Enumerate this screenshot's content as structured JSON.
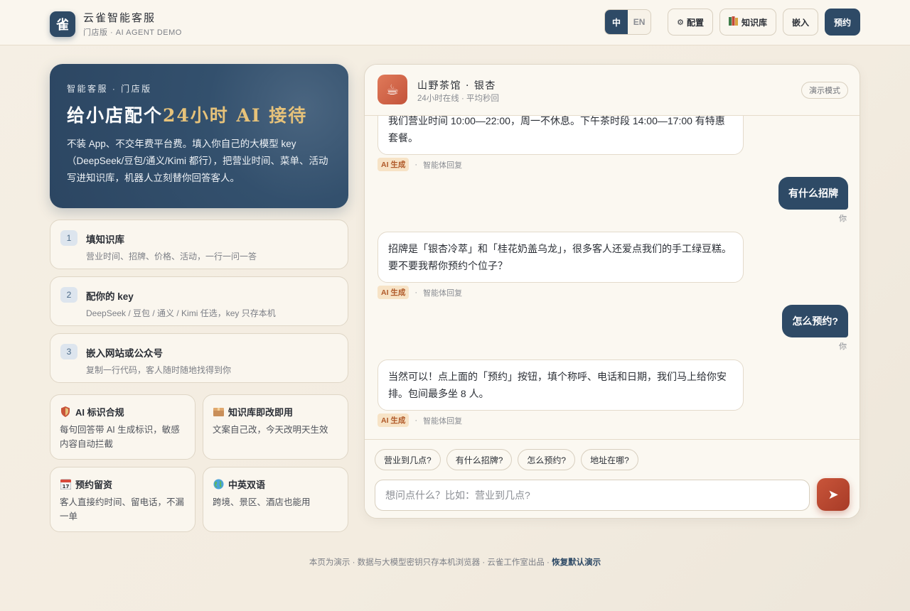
{
  "header": {
    "logo_char": "雀",
    "title": "云雀智能客服",
    "subtitle": "门店版 · AI AGENT DEMO",
    "lang_zh": "中",
    "lang_en": "EN",
    "btn_config": "配置",
    "btn_knowledge": "知识库",
    "btn_embed": "嵌入",
    "btn_book": "预约"
  },
  "hero": {
    "tag": "智能客服 · 门店版",
    "title_pre": "给小店配个",
    "title_accent": "24小时 AI 接待",
    "desc": "不装 App、不交年费平台费。填入你自己的大模型 key（DeepSeek/豆包/通义/Kimi 都行），把营业时间、菜单、活动写进知识库，机器人立刻替你回答客人。"
  },
  "steps": [
    {
      "num": "1",
      "title": "填知识库",
      "desc": "营业时间、招牌、价格、活动，一行一问一答"
    },
    {
      "num": "2",
      "title": "配你的 key",
      "desc": "DeepSeek / 豆包 / 通义 / Kimi 任选，key 只存本机"
    },
    {
      "num": "3",
      "title": "嵌入网站或公众号",
      "desc": "复制一行代码，客人随时随地找得到你"
    }
  ],
  "features": [
    {
      "icon": "shield-icon",
      "title": "AI 标识合规",
      "desc": "每句回答带 AI 生成标识，敏感内容自动拦截"
    },
    {
      "icon": "box-icon",
      "title": "知识库即改即用",
      "desc": "文案自己改，今天改明天生效"
    },
    {
      "icon": "calendar-icon",
      "title": "预约留资",
      "desc": "客人直接约时间、留电话，不漏一单"
    },
    {
      "icon": "globe-icon",
      "title": "中英双语",
      "desc": "跨境、景区、酒店也能用"
    }
  ],
  "chat": {
    "store_name": "山野茶馆 · 银杏",
    "store_status": "24小时在线 · 平均秒回",
    "mode_badge": "演示模式",
    "ai_tag": "AI 生成",
    "ai_meta": "智能体回复",
    "me_meta": "你",
    "messages": [
      {
        "role": "ai",
        "text": "我们营业时间 10:00—22:00，周一不休息。下午茶时段 14:00—17:00 有特惠套餐。"
      },
      {
        "role": "me",
        "text": "有什么招牌"
      },
      {
        "role": "ai",
        "text": "招牌是「银杏冷萃」和「桂花奶盖乌龙」，很多客人还爱点我们的手工绿豆糕。要不要我帮你预约个位子？"
      },
      {
        "role": "me",
        "text": "怎么预约?"
      },
      {
        "role": "ai",
        "text": "当然可以！点上面的「预约」按钮，填个称呼、电话和日期，我们马上给你安排。包间最多坐 8 人。"
      }
    ],
    "chips": [
      "营业到几点?",
      "有什么招牌?",
      "怎么预约?",
      "地址在哪?"
    ],
    "input_placeholder": "想问点什么？比如：营业到几点?",
    "input_value": ""
  },
  "footer": {
    "text": "本页为演示 · 数据与大模型密钥只存本机浏览器 · 云雀工作室出品 · ",
    "link": "恢复默认演示"
  },
  "colors": {
    "primary": "#2e4a66",
    "accent_gold": "#e6c27a",
    "send": "#b8462f",
    "ai_tag_bg": "#f7e3c6"
  }
}
